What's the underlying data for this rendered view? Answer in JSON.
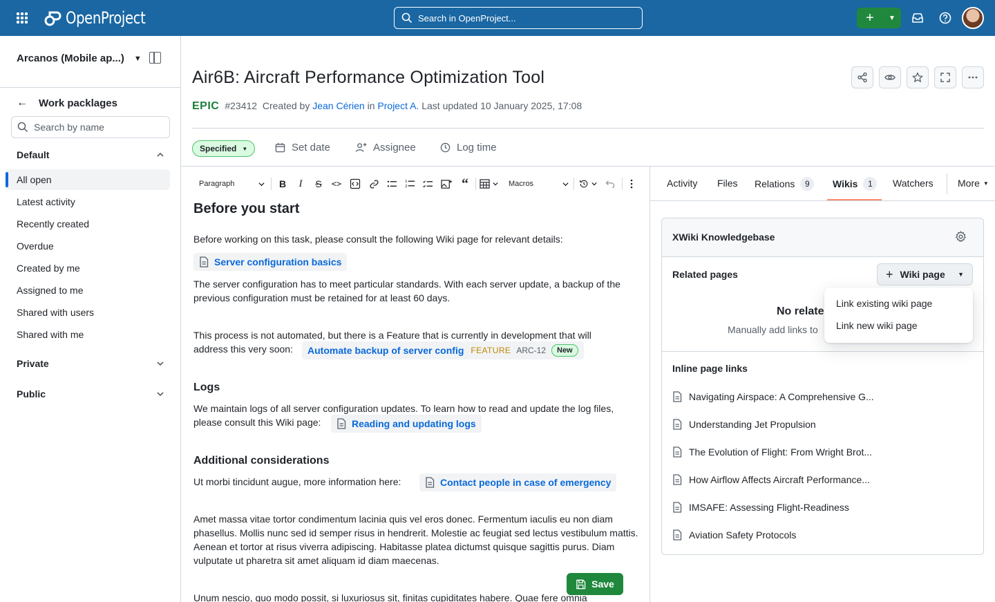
{
  "topbar": {
    "app_name": "OpenProject",
    "search_placeholder": "Search in OpenProject...",
    "create_label": "+"
  },
  "sidebar": {
    "project_name": "Arcanos (Mobile ap...)",
    "section_title": "Work packlages",
    "search_placeholder": "Search by name",
    "groups": [
      {
        "label": "Default",
        "expanded": true
      },
      {
        "label": "Private",
        "expanded": false
      },
      {
        "label": "Public",
        "expanded": false
      }
    ],
    "items": [
      {
        "label": "All open",
        "active": true
      },
      {
        "label": "Latest activity"
      },
      {
        "label": "Recently created"
      },
      {
        "label": "Overdue"
      },
      {
        "label": "Created by me"
      },
      {
        "label": "Assigned to me"
      },
      {
        "label": "Shared with users"
      },
      {
        "label": "Shared with me"
      }
    ]
  },
  "workpackage": {
    "title": "Air6B: Aircraft Performance Optimization Tool",
    "type": "EPIC",
    "id": "#23412",
    "created_by_prefix": "Created by",
    "author": "Jean Cérien",
    "in_word": "in",
    "project": "Project A.",
    "updated": "Last updated 10 January 2025, 17:08",
    "status": "Specified",
    "actions": {
      "set_date": "Set date",
      "assignee": "Assignee",
      "log_time": "Log time"
    }
  },
  "editor": {
    "paragraph_style": "Paragraph",
    "macros_label": "Macros",
    "heading1": "Before you start",
    "p1": "Before working on this task, please consult the following Wiki page for relevant details:",
    "chip1": "Server configuration basics",
    "p2": "The server configuration has to meet particular standards. With each server update, a backup of the previous configuration must be retained for at least 60 days.",
    "p3_line1": "This process is not automated, but there is a Feature that is currently in development that will",
    "p3_line2": "address this very soon:",
    "wp_chip": {
      "title": "Automate backup of server config",
      "type": "FEATURE",
      "id": "ARC-12",
      "status": "New"
    },
    "heading_logs": "Logs",
    "p4_line1": "We maintain logs of all server configuration updates. To learn how to read and update the log files,",
    "p4_line2": "please consult this Wiki page:",
    "chip2": "Reading and updating logs",
    "heading_additional": "Additional considerations",
    "p5": "Ut morbi tincidunt augue, more information here:",
    "chip3": "Contact people in case of emergency",
    "p6": "Amet massa vitae tortor condimentum lacinia quis vel eros donec. Fermentum iaculis eu non diam phasellus. Mollis nunc sed id semper risus in hendrerit. Molestie ac feugiat sed lectus vestibulum mattis. Aenean et tortor at risus viverra adipiscing. Habitasse platea dictumst quisque sagittis purus. Diam vulputate ut pharetra sit amet aliquam id diam maecenas.",
    "p7": "Unum nescio, quo modo possit, si luxuriosus sit, finitas cupiditates  habere. Quae fere omnia",
    "save_label": "Save"
  },
  "tabs": [
    {
      "label": "Activity"
    },
    {
      "label": "Files"
    },
    {
      "label": "Relations",
      "count": "9"
    },
    {
      "label": "Wikis",
      "count": "1",
      "active": true
    },
    {
      "label": "Watchers"
    },
    {
      "label": "More"
    }
  ],
  "wiki_panel": {
    "title": "XWiki Knowledgebase",
    "related_label": "Related pages",
    "wiki_page_button": "Wiki page",
    "empty_title": "No relate",
    "empty_sub": "Manually add links to",
    "menu": [
      "Link existing wiki page",
      "Link new wiki page"
    ],
    "inline_label": "Inline page links",
    "inline_links": [
      "Navigating Airspace: A Comprehensive G...",
      "Understanding Jet Propulsion",
      "The Evolution of Flight: From Wright Brot...",
      "How Airflow Affects Aircraft Performance...",
      "IMSAFE: Assessing Flight-Readiness",
      "Aviation Safety Protocols"
    ]
  },
  "colors": {
    "topbar": "#1a67a3",
    "primary_green": "#1f883d",
    "link_blue": "#0969da",
    "epic_green": "#1a7f37",
    "feature_amber": "#bf8700"
  }
}
